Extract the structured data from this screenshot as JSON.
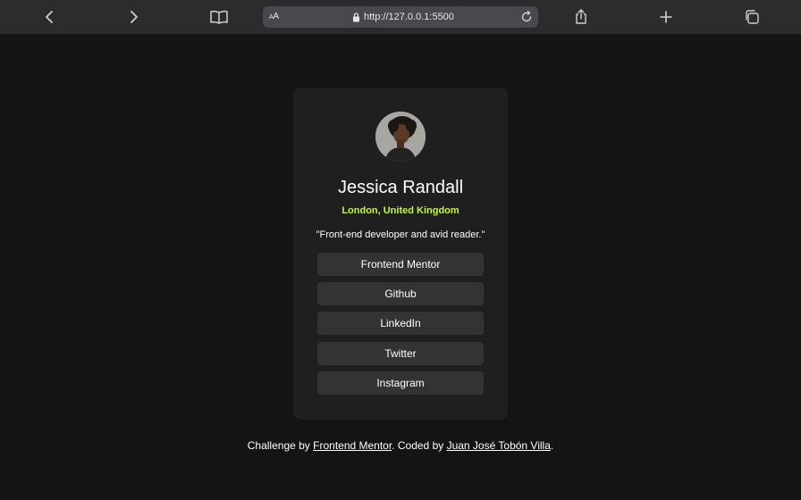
{
  "browser": {
    "aa_label_big": "A",
    "aa_label_small": "A",
    "url": "http://127.0.0.1:5500"
  },
  "profile": {
    "name": "Jessica Randall",
    "location": "London, United Kingdom",
    "bio": "\"Front-end developer and avid reader.\"",
    "links": [
      {
        "label": "Frontend Mentor"
      },
      {
        "label": "Github"
      },
      {
        "label": "LinkedIn"
      },
      {
        "label": "Twitter"
      },
      {
        "label": "Instagram"
      }
    ]
  },
  "footer": {
    "prefix": "Challenge by ",
    "challenge_link": "Frontend Mentor",
    "middle": ". Coded by ",
    "author_link": "Juan José Tobón Villa",
    "suffix": "."
  },
  "colors": {
    "page_bg": "#141414",
    "card_bg": "#1f1f1f",
    "button_bg": "#333333",
    "accent_green": "#c4f82a",
    "toolbar_bg": "#2b2c2e"
  }
}
